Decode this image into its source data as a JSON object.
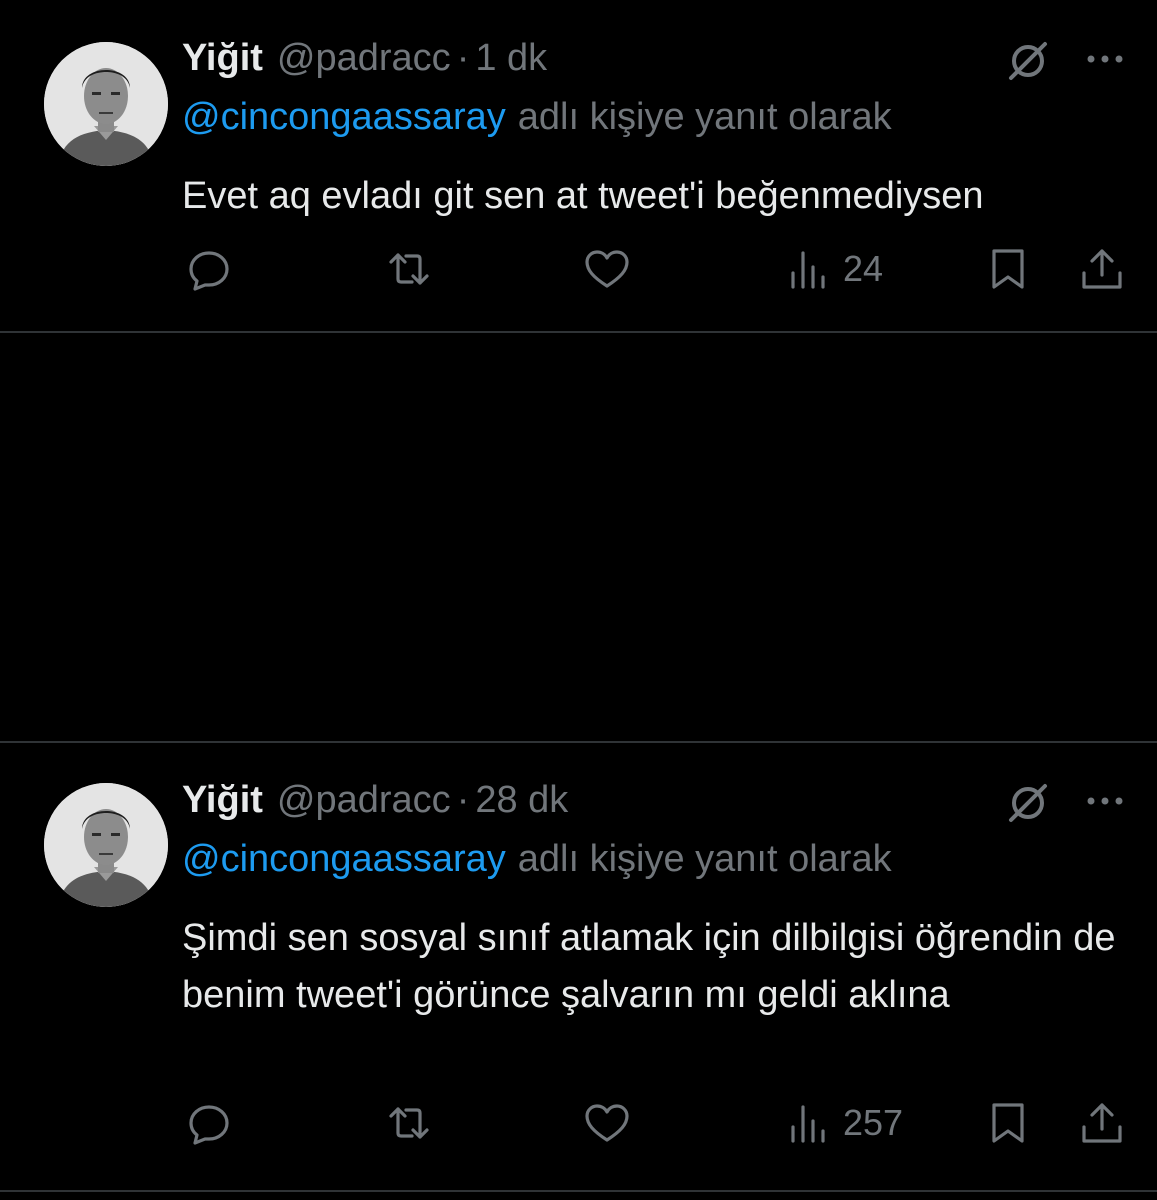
{
  "tweets": [
    {
      "name": "Yiğit",
      "handle": "@padracc",
      "separator": "·",
      "time": "1 dk",
      "reply_mention": "@cincongaassaray",
      "reply_suffix": "adlı kişiye yanıt olarak",
      "text": "Evet aq evladı git sen at tweet'i beğenmediysen",
      "views": "24"
    },
    {
      "name": "Yiğit",
      "handle": "@padracc",
      "separator": "·",
      "time": "28 dk",
      "reply_mention": "@cincongaassaray",
      "reply_suffix": "adlı kişiye yanıt olarak",
      "text": "Şimdi sen sosyal sınıf atlamak için dilbilgisi öğrendin de benim tweet'i görünce şalvarın mı geldi aklına",
      "views": "257"
    }
  ],
  "icons": {
    "reply": "reply-icon",
    "retweet": "retweet-icon",
    "like": "heart-icon",
    "views": "views-icon",
    "bookmark": "bookmark-icon",
    "share": "share-icon",
    "grok": "grok-icon",
    "more": "more-icon"
  },
  "colors": {
    "background": "#000000",
    "text": "#e7e9ea",
    "muted": "#71767b",
    "link": "#1d9bf0",
    "divider": "#2f3336"
  }
}
